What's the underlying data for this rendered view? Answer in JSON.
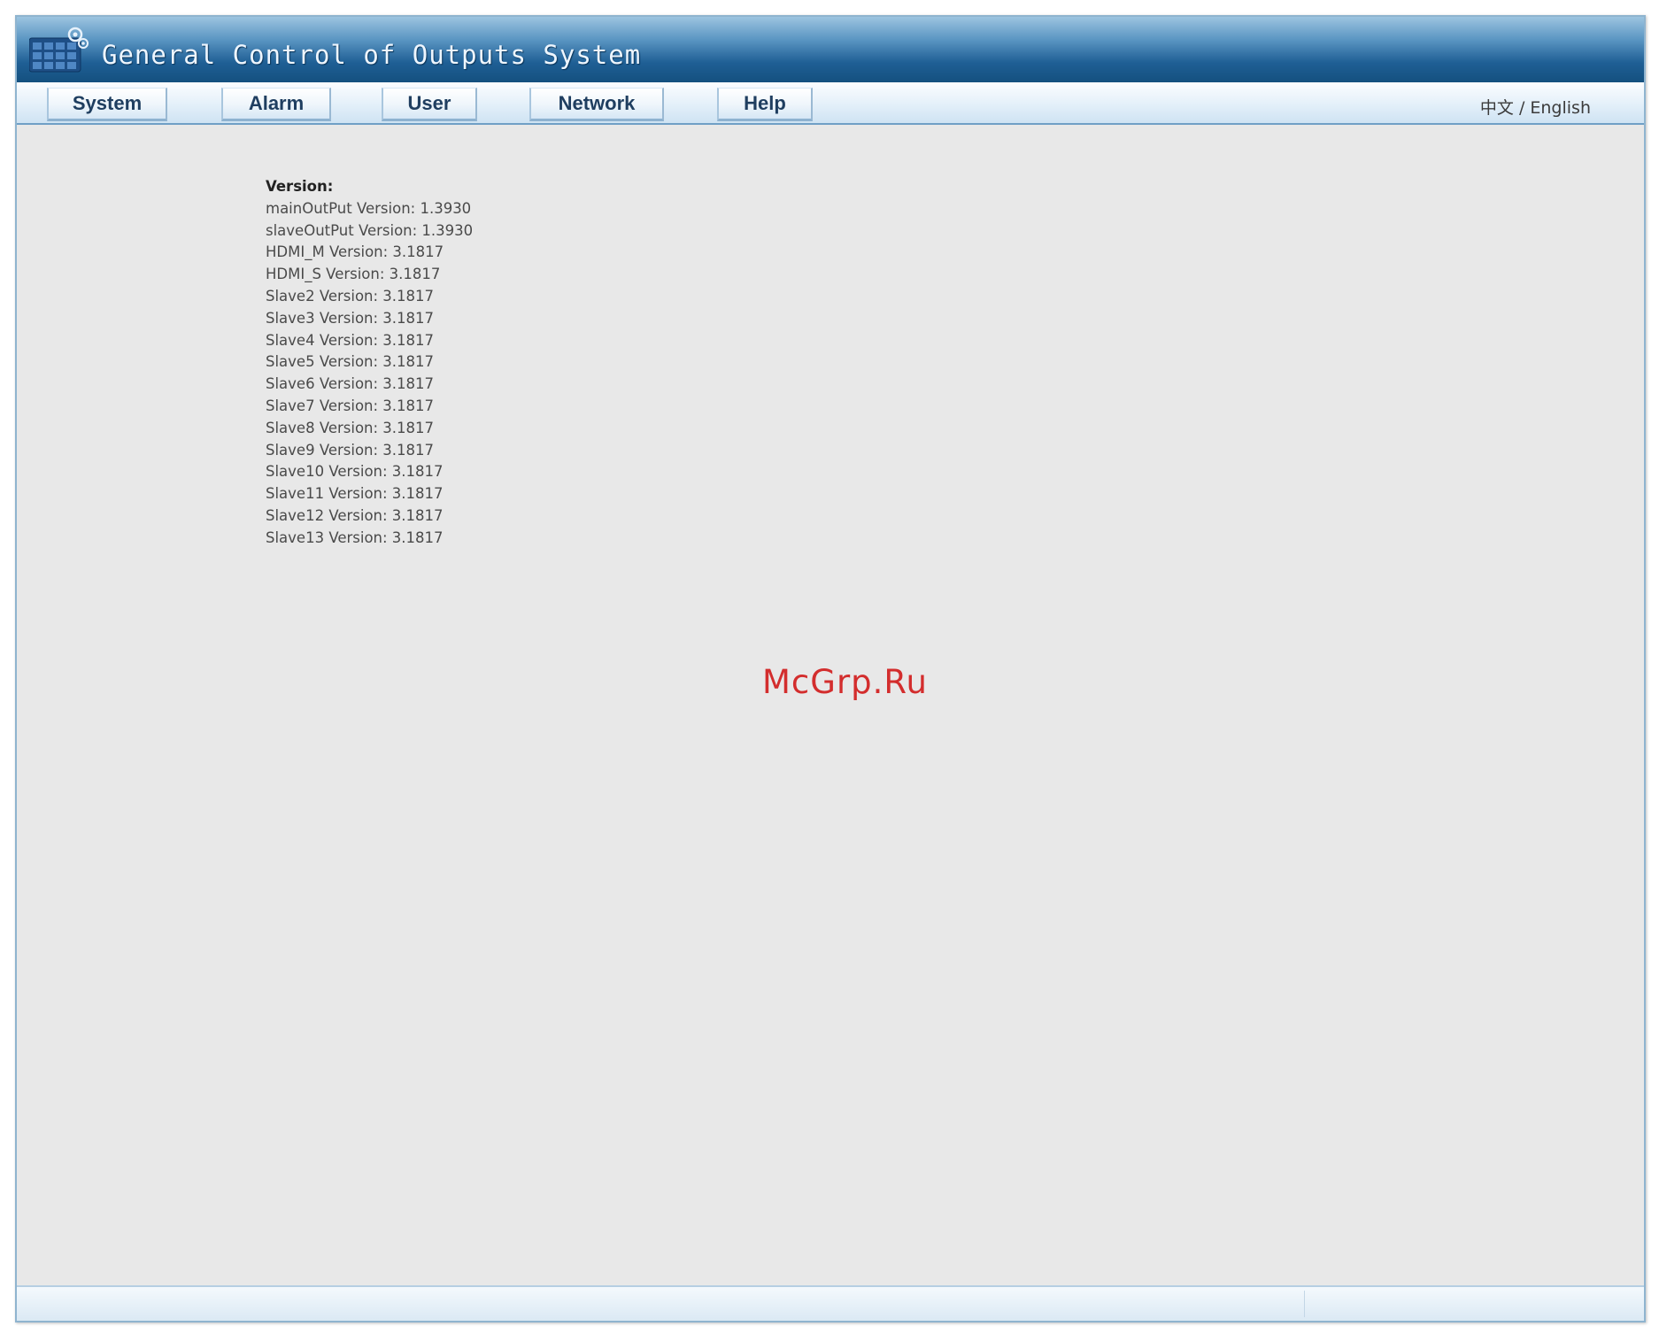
{
  "app": {
    "title": "General Control of Outputs System"
  },
  "nav": {
    "items": [
      {
        "label": "System"
      },
      {
        "label": "Alarm"
      },
      {
        "label": "User"
      },
      {
        "label": "Network"
      },
      {
        "label": "Help"
      }
    ],
    "language_switch": "中文 / English"
  },
  "versions": {
    "heading": "Version:",
    "lines": [
      "mainOutPut Version: 1.3930",
      "slaveOutPut Version: 1.3930",
      "HDMI_M Version: 3.1817",
      "HDMI_S Version: 3.1817",
      "Slave2 Version: 3.1817",
      "Slave3 Version: 3.1817",
      "Slave4 Version: 3.1817",
      "Slave5 Version: 3.1817",
      "Slave6 Version: 3.1817",
      "Slave7 Version: 3.1817",
      "Slave8 Version: 3.1817",
      "Slave9 Version: 3.1817",
      "Slave10 Version: 3.1817",
      "Slave11 Version: 3.1817",
      "Slave12 Version: 3.1817",
      "Slave13 Version: 3.1817"
    ]
  },
  "watermark": "McGrp.Ru",
  "colors": {
    "title_bar": "#1f5f95",
    "content_bg": "#e8e8e8",
    "watermark": "#d32d2d"
  }
}
